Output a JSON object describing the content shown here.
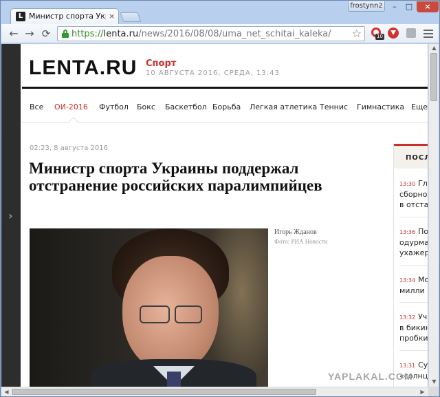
{
  "browser": {
    "tab_title": "Министр спорта Украины п",
    "tab_favicon_letter": "L",
    "tab_close": "×",
    "user_name": "frostynn2",
    "window_buttons": {
      "minimize": "–",
      "maximize": "□",
      "close": "×"
    },
    "nav": {
      "back": "←",
      "forward": "→",
      "reload": "⟳"
    },
    "url": {
      "scheme": "https://",
      "host": "lenta.ru",
      "path": "/news/2016/08/08/uma_net_schitai_kaleka/"
    },
    "extensions": [
      {
        "name": "opera-extension-icon",
        "badge": "10"
      },
      {
        "name": "download-extension-icon"
      },
      {
        "name": "gray-extension-icon"
      }
    ]
  },
  "site": {
    "logo": "LENTA.RU",
    "section": "Спорт",
    "dateline": "10 АВГУСТА 2016, СРЕДА, 13:43",
    "nav_items": [
      "Все",
      "ОИ-2016",
      "Футбол",
      "Бокс",
      "Баскетбол",
      "Борьба",
      "Легкая атлетика",
      "Теннис",
      "Гимнастика",
      "Еще"
    ],
    "active_nav": "ОИ-2016"
  },
  "article": {
    "time": "02:23, 8 августа 2016",
    "headline": "Министр спорта Украины поддержал отстранение российских паралимпийцев",
    "photo_author": "Игорь Жданов",
    "photo_credit": "Фото: РИА Новости"
  },
  "latest": {
    "header": "ПОСЛ",
    "items": [
      {
        "time": "13:30",
        "lines": [
          "Гла",
          "сборной",
          "в отстав"
        ]
      },
      {
        "time": "13:36",
        "lines": [
          "По",
          "одурман",
          "ухажер"
        ]
      },
      {
        "time": "13:34",
        "lines": [
          "Мо",
          "милли"
        ]
      },
      {
        "time": "13:32",
        "lines": [
          "Уча",
          "в бикин",
          "пробки"
        ]
      },
      {
        "time": "13:31",
        "lines": [
          "Суд",
          "«солнц"
        ]
      }
    ]
  },
  "watermark": "YAPLAKAL.COM",
  "scroll_arrows": {
    "up": "▲",
    "down": "▼",
    "left": "◀",
    "right": "▶"
  }
}
